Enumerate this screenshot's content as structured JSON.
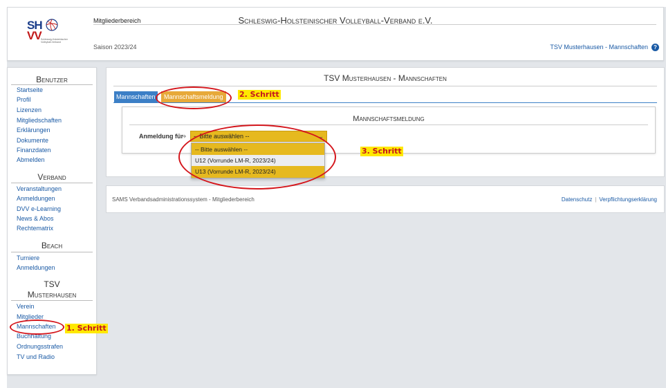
{
  "header": {
    "logo_text_top": "SH",
    "logo_text_bottom": "VV",
    "logo_subtitle": "Schleswig-Holsteinischer Volleyball-Verband",
    "site_title": "Schleswig-Holsteinischer Volleyball-Verband e.V.",
    "area": "Mitgliederbereich",
    "season": "Saison 2023/24",
    "club_link": "TSV Musterhausen - Mannschaften",
    "help_symbol": "?"
  },
  "sidebar": {
    "sections": [
      {
        "title": "Benutzer",
        "items": [
          "Startseite",
          "Profil",
          "Lizenzen",
          "Mitgliedschaften",
          "Erklärungen",
          "Dokumente",
          "Finanzdaten",
          "Abmelden"
        ]
      },
      {
        "title": "Verband",
        "items": [
          "Veranstaltungen",
          "Anmeldungen",
          "DVV e-Learning",
          "News & Abos",
          "Rechtematrix"
        ]
      },
      {
        "title": "Beach",
        "items": [
          "Turniere",
          "Anmeldungen"
        ]
      },
      {
        "title_line1": "TSV",
        "title_line2": "Musterhausen",
        "items": [
          "Verein",
          "Mitglieder",
          "Mannschaften",
          "Buchhaltung",
          "Ordnungsstrafen",
          "TV und Radio"
        ]
      }
    ]
  },
  "main": {
    "title": "TSV Musterhausen - Mannschaften",
    "tabs": [
      {
        "label": "Mannschaften"
      },
      {
        "label": "Mannschaftsmeldung"
      }
    ],
    "form": {
      "title": "Mannschaftsmeldung",
      "label": "Anmeldung für",
      "arrow": "➔",
      "selected": "-- Bitte auswählen --",
      "caret": "⌄",
      "options": [
        "-- Bitte auswählen --",
        "U12 (Vorrunde LM-R, 2023/24)",
        "U13 (Vorrunde LM-R, 2023/24)"
      ]
    }
  },
  "footer": {
    "text": "SAMS Verbandsadministrationssystem - Mitgliederbereich",
    "links": [
      "Datenschutz",
      "Verpflichtungserklärung"
    ],
    "separator": "|"
  },
  "annotations": {
    "step1": "1. Schritt",
    "step2": "2. Schritt",
    "step3": "3. Schritt"
  },
  "colors": {
    "link": "#1a5aa5",
    "tab_active": "#3c7fc6",
    "tab_highlight": "#e7a93a",
    "select_bg": "#e6b91f",
    "annotation_red": "#d4161c",
    "annotation_yellow": "#ffe800"
  }
}
